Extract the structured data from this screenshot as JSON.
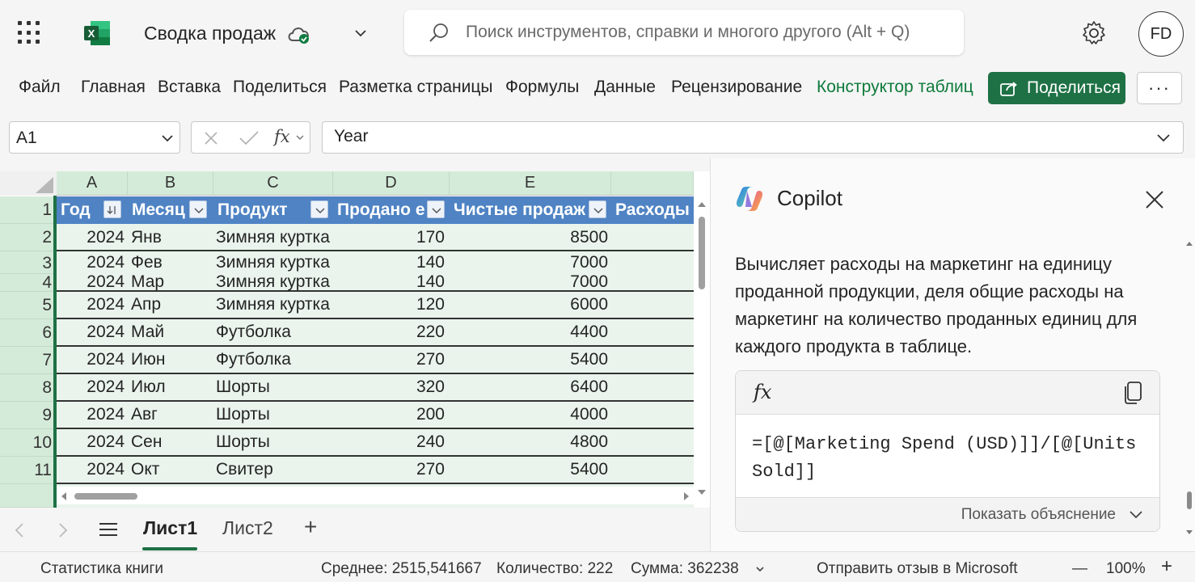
{
  "titlebar": {
    "doc_title": "Сводка продаж",
    "search_placeholder": "Поиск инструментов, справки и многого другого (Alt + Q)",
    "avatar_initials": "FD"
  },
  "ribbon": {
    "tabs": [
      "Файл",
      "Главная",
      "Вставка",
      "Поделиться",
      "Разметка страницы",
      "Формулы",
      "Данные",
      "Рецензирование",
      "Конструктор таблиц"
    ],
    "share_label": "Поделиться",
    "more_label": "···"
  },
  "formula_bar": {
    "name_box": "A1",
    "fx_label": "fx",
    "formula": "Year"
  },
  "grid": {
    "columns": [
      "A",
      "B",
      "C",
      "D",
      "E"
    ],
    "row_numbers": [
      "1",
      "2",
      "3",
      "4",
      "5",
      "6",
      "7",
      "8",
      "9",
      "10",
      "11"
    ],
    "headers": [
      "Год",
      "Месяц",
      "Продукт",
      "Продано е",
      "Чистые продаж",
      "Расходы"
    ],
    "rows": [
      [
        "2024",
        "Янв",
        "Зимняя куртка",
        "170",
        "8500"
      ],
      [
        "2024",
        "Фев",
        "Зимняя куртка",
        "140",
        "7000"
      ],
      [
        "2024",
        "Мар",
        "Зимняя куртка",
        "140",
        "7000"
      ],
      [
        "2024",
        "Апр",
        "Зимняя куртка",
        "120",
        "6000"
      ],
      [
        "2024",
        "Май",
        "Футболка",
        "220",
        "4400"
      ],
      [
        "2024",
        "Июн",
        "Футболка",
        "270",
        "5400"
      ],
      [
        "2024",
        "Июл",
        "Шорты",
        "320",
        "6400"
      ],
      [
        "2024",
        "Авг",
        "Шорты",
        "200",
        "4000"
      ],
      [
        "2024",
        "Сен",
        "Шорты",
        "240",
        "4800"
      ],
      [
        "2024",
        "Окт",
        "Свитер",
        "270",
        "5400"
      ]
    ]
  },
  "sheets": {
    "tabs": [
      "Лист1",
      "Лист2"
    ],
    "active": "Лист1",
    "add_label": "+"
  },
  "copilot": {
    "title": "Copilot",
    "description": "Вычисляет расходы на маркетинг на единицу проданной продукции, деля общие расходы на маркетинг на количество проданных единиц для каждого продукта в таблице.",
    "fx_label": "fx",
    "formula": "=[@[Marketing Spend (USD)]]/[@[Units Sold]]",
    "explain_label": "Показать объяснение"
  },
  "statusbar": {
    "workbook_stats": "Статистика книги",
    "average": "Среднее: 2515,541667",
    "count": "Количество: 222",
    "sum": "Сумма: 362238",
    "feedback": "Отправить отзыв в Microsoft",
    "zoom_minus": "—",
    "zoom": "100%",
    "zoom_plus": "+"
  },
  "colors": {
    "accent_green": "#1e7145",
    "table_header_blue": "#4f83c4",
    "selection_green": "#d5ebd9"
  }
}
